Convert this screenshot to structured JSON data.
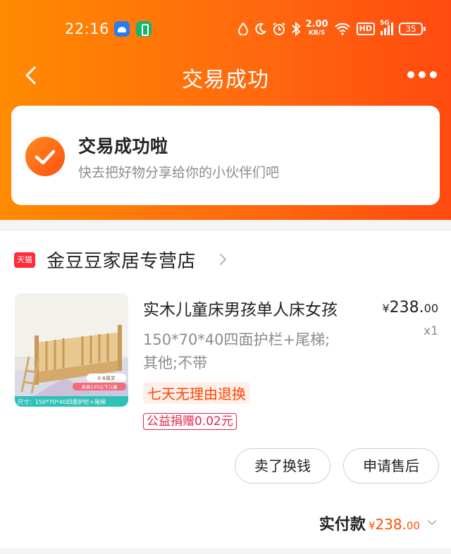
{
  "status_bar": {
    "time": "22:16",
    "net_speed": "2.00",
    "net_unit": "KB/S",
    "hd": "HD",
    "network": "5G",
    "battery": "35"
  },
  "nav": {
    "title": "交易成功"
  },
  "success": {
    "title": "交易成功啦",
    "subtitle": "快去把好物分享给你的小伙伴们吧"
  },
  "store": {
    "badge": "天猫",
    "name": "金豆豆家居专营店"
  },
  "product": {
    "title": "实木儿童床男孩单人床女孩",
    "spec_line1": "150*70*40四面护栏+尾梯;",
    "spec_line2": "其他;不带",
    "price_symbol": "¥",
    "price_int": "238.",
    "price_dec": "00",
    "quantity": "x1",
    "tag_return": "七天无理由退换",
    "tag_charity": "公益捐赠0.02元",
    "image_caption": "尺寸：150*70*40四面护栏+尾梯",
    "image_badge_line1": "0-8周岁",
    "image_badge_line2": "身高135以下儿童"
  },
  "actions": {
    "sell": "卖了换钱",
    "after_sale": "申请售后"
  },
  "total": {
    "label": "实付款",
    "symbol": "¥",
    "int": "238.",
    "dec": "00"
  },
  "colors": {
    "header_start": "#ff8a00",
    "header_end": "#ff4a10",
    "accent": "#ff5000",
    "charity": "#e3264b"
  }
}
